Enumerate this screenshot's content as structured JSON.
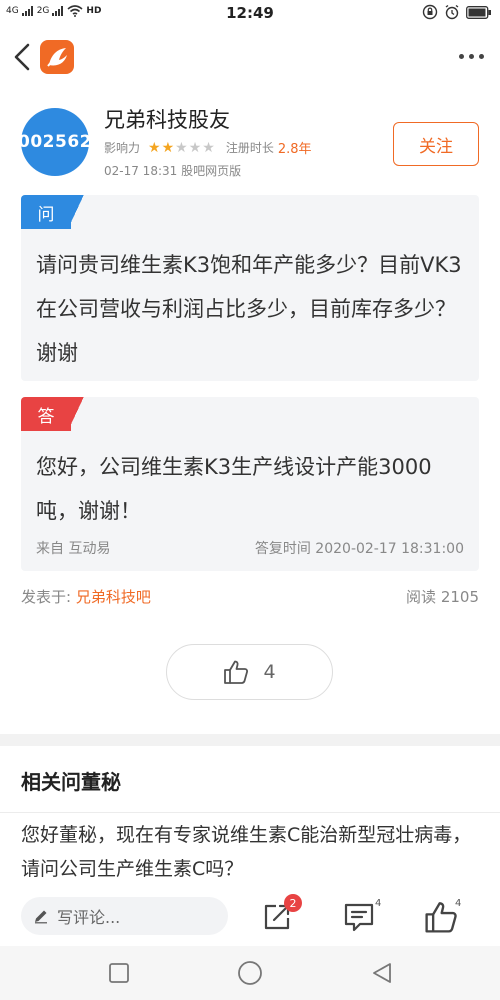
{
  "status_bar": {
    "left_labels": [
      "4G",
      "2G"
    ],
    "hd": "HD",
    "time": "12:49"
  },
  "user": {
    "avatar_code": "002562",
    "name": "兄弟科技股友",
    "influence_label": "影响力",
    "stars_filled": 2,
    "stars_total": 5,
    "registered_label": "注册时长",
    "registered_value": "2.8年",
    "post_time": "02-17 18:31 股吧网页版",
    "follow_label": "关注"
  },
  "question": {
    "tag": "问",
    "text": "请问贵司维生素K3饱和年产能多少？目前VK3在公司营收与利润占比多少，目前库存多少？谢谢"
  },
  "answer": {
    "tag": "答",
    "text": "您好，公司维生素K3生产线设计产能3000吨，谢谢！",
    "source": "来自 互动易",
    "reply_time": "答复时间 2020-02-17 18:31:00"
  },
  "posted": {
    "label": "发表于:",
    "bar_name": "兄弟科技吧",
    "read_label": "阅读",
    "read_count": "2105"
  },
  "like_count": "4",
  "related": {
    "title": "相关问董秘",
    "first_item": "您好董秘，现在有专家说维生素C能治新型冠壮病毒，请问公司生产维生素C吗？"
  },
  "action_bar": {
    "comment_placeholder": "写评论...",
    "share_badge": "2",
    "comment_count": "4",
    "like_count": "4"
  },
  "colors": {
    "accent": "#f06a25",
    "question_blue": "#2e8ae0",
    "answer_red": "#e84343",
    "star_gold": "#f4a521"
  }
}
